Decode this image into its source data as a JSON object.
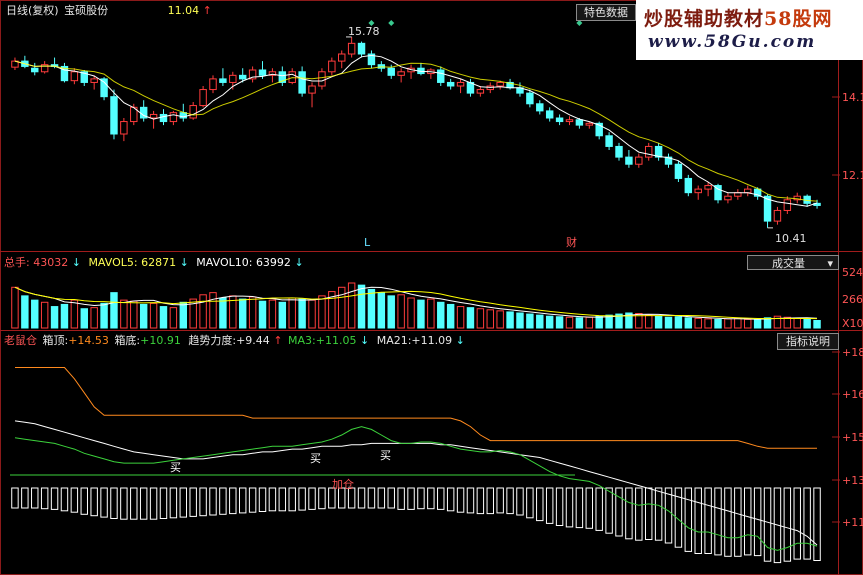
{
  "header": {
    "period_label": "日线(复权)",
    "stock_name": "宝硕股份",
    "current_price": "11.04",
    "special_data_btn": "特色数据"
  },
  "watermark": {
    "line1_a": "炒股辅助教材",
    "line1_b": "58股网",
    "line2": "www.58Gu.com"
  },
  "price_panel": {
    "high_label": "15.78",
    "low_label": "10.41",
    "axis_ticks": [
      "14.1",
      "12.1"
    ],
    "markers": [
      "L",
      "财"
    ]
  },
  "volume_panel": {
    "title": "总手:",
    "total": "43032",
    "mavol5_label": "MAVOL5:",
    "mavol5": "62871",
    "mavol10_label": "MAVOL10:",
    "mavol10": "63992",
    "dropdown_label": "成交量",
    "axis_ticks": [
      "524",
      "266",
      "X10"
    ]
  },
  "indicator_panel": {
    "name": "老鼠仓",
    "box_top_label": "箱顶:",
    "box_top": "+14.53",
    "box_bottom_label": "箱底:",
    "box_bottom": "+10.91",
    "trend_label": "趋势力度:",
    "trend": "+9.44",
    "ma3_label": "MA3:",
    "ma3": "+11.05",
    "ma21_label": "MA21:",
    "ma21": "+11.09",
    "help_btn": "指标说明",
    "axis_ticks": [
      "+18",
      "+16",
      "+15",
      "+13",
      "+11"
    ],
    "annotations": [
      "买",
      "买",
      "买",
      "加仓"
    ]
  },
  "colors": {
    "up": "#ff3c3c",
    "down": "#54ffff",
    "ma_white": "#ffffff",
    "ma_yellow": "#ffff00",
    "box_orange": "#ff8a1e",
    "green_line": "#3cd23c",
    "axis_red": "#ff4a4a",
    "marker_green": "#39c98f"
  },
  "chart_data": {
    "type": "candlestick",
    "price_range": [
      9.9,
      16.2
    ],
    "candles": [
      [
        14.93,
        15.2,
        14.85,
        15.1
      ],
      [
        15.1,
        15.25,
        14.9,
        14.95
      ],
      [
        14.9,
        15.05,
        14.7,
        14.8
      ],
      [
        14.8,
        15.1,
        14.75,
        15.0
      ],
      [
        15.0,
        15.2,
        14.9,
        14.95
      ],
      [
        14.95,
        15.05,
        14.5,
        14.55
      ],
      [
        14.55,
        14.9,
        14.45,
        14.8
      ],
      [
        14.8,
        14.85,
        14.4,
        14.5
      ],
      [
        14.5,
        14.7,
        14.3,
        14.6
      ],
      [
        14.6,
        14.65,
        14.0,
        14.1
      ],
      [
        14.1,
        14.3,
        12.9,
        13.05
      ],
      [
        13.05,
        13.5,
        12.85,
        13.4
      ],
      [
        13.4,
        13.9,
        13.3,
        13.8
      ],
      [
        13.8,
        14.0,
        13.4,
        13.5
      ],
      [
        13.5,
        13.7,
        13.2,
        13.6
      ],
      [
        13.6,
        13.75,
        13.3,
        13.4
      ],
      [
        13.4,
        13.7,
        13.3,
        13.65
      ],
      [
        13.65,
        13.9,
        13.4,
        13.5
      ],
      [
        13.5,
        13.95,
        13.45,
        13.85
      ],
      [
        13.85,
        14.4,
        13.8,
        14.3
      ],
      [
        14.3,
        14.7,
        14.2,
        14.6
      ],
      [
        14.6,
        14.9,
        14.4,
        14.5
      ],
      [
        14.5,
        14.8,
        14.3,
        14.7
      ],
      [
        14.7,
        14.9,
        14.5,
        14.6
      ],
      [
        14.6,
        14.95,
        14.5,
        14.85
      ],
      [
        14.85,
        15.1,
        14.6,
        14.7
      ],
      [
        14.7,
        14.9,
        14.5,
        14.8
      ],
      [
        14.8,
        14.95,
        14.4,
        14.5
      ],
      [
        14.5,
        14.9,
        14.45,
        14.8
      ],
      [
        14.8,
        14.95,
        14.1,
        14.2
      ],
      [
        14.2,
        14.5,
        13.8,
        14.4
      ],
      [
        14.4,
        14.9,
        14.3,
        14.8
      ],
      [
        14.8,
        15.2,
        14.7,
        15.1
      ],
      [
        15.1,
        15.4,
        14.9,
        15.3
      ],
      [
        15.3,
        15.78,
        15.2,
        15.6
      ],
      [
        15.6,
        15.65,
        15.2,
        15.3
      ],
      [
        15.3,
        15.4,
        14.9,
        15.0
      ],
      [
        15.0,
        15.1,
        14.8,
        14.9
      ],
      [
        14.9,
        15.0,
        14.6,
        14.7
      ],
      [
        14.7,
        14.9,
        14.5,
        14.8
      ],
      [
        14.8,
        15.0,
        14.6,
        14.9
      ],
      [
        14.9,
        15.05,
        14.7,
        14.75
      ],
      [
        14.75,
        14.9,
        14.6,
        14.85
      ],
      [
        14.85,
        14.95,
        14.4,
        14.5
      ],
      [
        14.5,
        14.6,
        14.3,
        14.4
      ],
      [
        14.4,
        14.6,
        14.2,
        14.5
      ],
      [
        14.5,
        14.6,
        14.1,
        14.2
      ],
      [
        14.2,
        14.4,
        14.1,
        14.3
      ],
      [
        14.3,
        14.5,
        14.2,
        14.4
      ],
      [
        14.4,
        14.55,
        14.3,
        14.5
      ],
      [
        14.5,
        14.6,
        14.3,
        14.35
      ],
      [
        14.35,
        14.5,
        14.1,
        14.2
      ],
      [
        14.2,
        14.3,
        13.8,
        13.9
      ],
      [
        13.9,
        14.0,
        13.6,
        13.7
      ],
      [
        13.7,
        13.8,
        13.4,
        13.5
      ],
      [
        13.5,
        13.6,
        13.3,
        13.4
      ],
      [
        13.4,
        13.55,
        13.3,
        13.45
      ],
      [
        13.45,
        13.5,
        13.2,
        13.3
      ],
      [
        13.3,
        13.4,
        13.2,
        13.35
      ],
      [
        13.35,
        13.4,
        12.9,
        13.0
      ],
      [
        13.0,
        13.1,
        12.6,
        12.7
      ],
      [
        12.7,
        12.8,
        12.3,
        12.4
      ],
      [
        12.4,
        12.6,
        12.1,
        12.2
      ],
      [
        12.2,
        12.5,
        12.1,
        12.4
      ],
      [
        12.4,
        12.8,
        12.3,
        12.7
      ],
      [
        12.7,
        12.8,
        12.3,
        12.4
      ],
      [
        12.4,
        12.5,
        12.1,
        12.2
      ],
      [
        12.2,
        12.3,
        11.7,
        11.8
      ],
      [
        11.8,
        11.9,
        11.3,
        11.4
      ],
      [
        11.4,
        11.6,
        11.2,
        11.5
      ],
      [
        11.5,
        11.7,
        11.3,
        11.6
      ],
      [
        11.6,
        11.65,
        11.1,
        11.2
      ],
      [
        11.2,
        11.4,
        11.1,
        11.3
      ],
      [
        11.3,
        11.5,
        11.2,
        11.4
      ],
      [
        11.4,
        11.6,
        11.3,
        11.5
      ],
      [
        11.5,
        11.55,
        11.2,
        11.3
      ],
      [
        11.3,
        11.35,
        10.41,
        10.6
      ],
      [
        10.6,
        11.0,
        10.5,
        10.9
      ],
      [
        10.9,
        11.3,
        10.8,
        11.2
      ],
      [
        11.2,
        11.4,
        11.1,
        11.3
      ],
      [
        11.3,
        11.35,
        11.0,
        11.1
      ],
      [
        11.1,
        11.2,
        10.95,
        11.04
      ]
    ],
    "volumes": [
      380,
      300,
      260,
      240,
      200,
      220,
      260,
      180,
      190,
      230,
      330,
      260,
      250,
      220,
      230,
      200,
      190,
      240,
      270,
      310,
      330,
      280,
      300,
      270,
      290,
      250,
      260,
      240,
      280,
      270,
      260,
      300,
      340,
      380,
      420,
      400,
      360,
      330,
      300,
      310,
      280,
      260,
      270,
      240,
      220,
      200,
      190,
      180,
      170,
      160,
      150,
      140,
      130,
      120,
      110,
      105,
      100,
      95,
      100,
      110,
      120,
      130,
      140,
      135,
      120,
      110,
      100,
      105,
      95,
      90,
      85,
      80,
      85,
      90,
      80,
      75,
      95,
      110,
      100,
      90,
      85,
      70
    ],
    "box_top": [
      17.4,
      17.4,
      17.4,
      17.4,
      17.4,
      17.4,
      17.0,
      16.5,
      16.0,
      15.7,
      15.7,
      15.7,
      15.7,
      15.7,
      15.7,
      15.7,
      15.7,
      15.7,
      15.7,
      15.7,
      15.7,
      15.7,
      15.7,
      15.7,
      15.6,
      15.6,
      15.6,
      15.6,
      15.6,
      15.6,
      15.6,
      15.6,
      15.6,
      15.6,
      15.6,
      15.6,
      15.6,
      15.6,
      15.6,
      15.6,
      15.6,
      15.6,
      15.6,
      15.6,
      15.6,
      15.5,
      15.3,
      15.0,
      14.8,
      14.8,
      14.8,
      14.8,
      14.8,
      14.8,
      14.8,
      14.8,
      14.8,
      14.8,
      14.8,
      14.8,
      14.8,
      14.8,
      14.8,
      14.8,
      14.8,
      14.8,
      14.8,
      14.8,
      14.8,
      14.8,
      14.8,
      14.8,
      14.8,
      14.8,
      14.7,
      14.6,
      14.53,
      14.53,
      14.53,
      14.53,
      14.53,
      14.53
    ],
    "ma21": [
      15.5,
      15.45,
      15.4,
      15.3,
      15.2,
      15.1,
      15.0,
      14.9,
      14.8,
      14.7,
      14.6,
      14.5,
      14.4,
      14.35,
      14.3,
      14.25,
      14.2,
      14.15,
      14.15,
      14.15,
      14.2,
      14.25,
      14.3,
      14.3,
      14.35,
      14.4,
      14.4,
      14.45,
      14.5,
      14.5,
      14.55,
      14.6,
      14.6,
      14.6,
      14.65,
      14.65,
      14.7,
      14.7,
      14.7,
      14.7,
      14.7,
      14.7,
      14.7,
      14.65,
      14.65,
      14.6,
      14.55,
      14.5,
      14.45,
      14.4,
      14.35,
      14.3,
      14.25,
      14.2,
      14.1,
      14.0,
      13.9,
      13.8,
      13.7,
      13.6,
      13.5,
      13.4,
      13.3,
      13.2,
      13.1,
      13.0,
      12.9,
      12.8,
      12.7,
      12.6,
      12.5,
      12.4,
      12.3,
      12.2,
      12.1,
      12.0,
      11.9,
      11.8,
      11.7,
      11.6,
      11.4,
      11.09
    ],
    "ma3": [
      14.9,
      14.85,
      14.8,
      14.75,
      14.7,
      14.6,
      14.5,
      14.35,
      14.25,
      14.15,
      14.05,
      14.0,
      14.0,
      14.0,
      14.0,
      14.05,
      14.1,
      14.15,
      14.2,
      14.25,
      14.3,
      14.35,
      14.4,
      14.45,
      14.5,
      14.55,
      14.6,
      14.6,
      14.6,
      14.65,
      14.7,
      14.75,
      14.85,
      15.0,
      15.2,
      15.3,
      15.2,
      15.0,
      14.8,
      14.7,
      14.7,
      14.75,
      14.75,
      14.7,
      14.6,
      14.5,
      14.45,
      14.4,
      14.4,
      14.45,
      14.4,
      14.3,
      14.1,
      13.9,
      13.7,
      13.55,
      13.45,
      13.4,
      13.35,
      13.2,
      13.0,
      12.8,
      12.6,
      12.5,
      12.55,
      12.5,
      12.3,
      12.0,
      11.7,
      11.55,
      11.55,
      11.45,
      11.35,
      11.35,
      11.45,
      11.4,
      11.0,
      10.9,
      11.0,
      11.15,
      11.15,
      11.05
    ]
  }
}
